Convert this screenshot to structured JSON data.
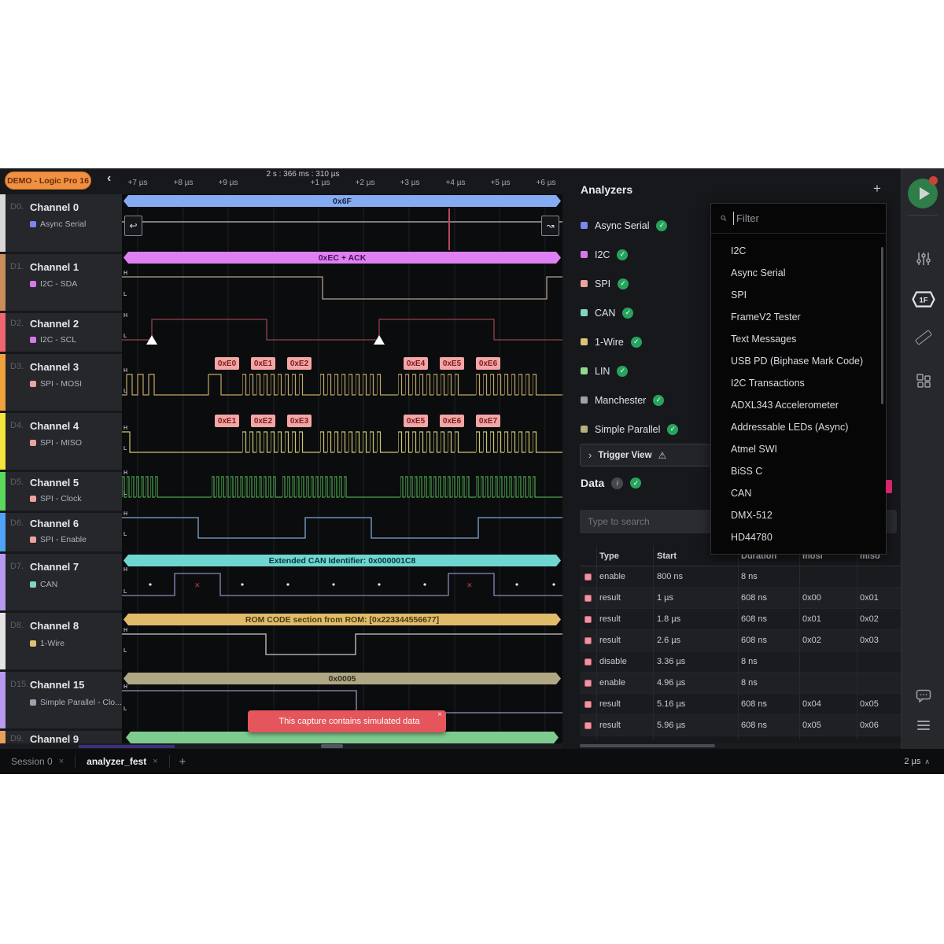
{
  "header": {
    "demo_badge": "DEMO - Logic Pro 16",
    "time_readout": "2 s : 366 ms : 310 µs",
    "ticks": [
      "+7 µs",
      "+8 µs",
      "+9 µs",
      "+1 µs",
      "+2 µs",
      "+3 µs",
      "+4 µs",
      "+5 µs",
      "+6 µs"
    ]
  },
  "channels": [
    {
      "id": "D0.",
      "name": "Channel 0",
      "tag": "Async Serial",
      "color": "#d8d8d8",
      "tag_color": "#7b86ee"
    },
    {
      "id": "D1.",
      "name": "Channel 1",
      "tag": "I2C - SDA",
      "color": "#c98d5a",
      "tag_color": "#d678e8"
    },
    {
      "id": "D2.",
      "name": "Channel 2",
      "tag": "I2C - SCL",
      "color": "#ef6670",
      "tag_color": "#d678e8"
    },
    {
      "id": "D3.",
      "name": "Channel 3",
      "tag": "SPI - MOSI",
      "color": "#f0a23c",
      "tag_color": "#f0a0a0"
    },
    {
      "id": "D4.",
      "name": "Channel 4",
      "tag": "SPI - MISO",
      "color": "#f5e53a",
      "tag_color": "#f0a0a0"
    },
    {
      "id": "D5.",
      "name": "Channel 5",
      "tag": "SPI - Clock",
      "color": "#5ad95a",
      "tag_color": "#f0a0a0"
    },
    {
      "id": "D6.",
      "name": "Channel 6",
      "tag": "SPI - Enable",
      "color": "#4da3f5",
      "tag_color": "#f0a0a0"
    },
    {
      "id": "D7.",
      "name": "Channel 7",
      "tag": "CAN",
      "color": "#b59af0",
      "tag_color": "#7fd4c4"
    },
    {
      "id": "D8.",
      "name": "Channel 8",
      "tag": "1-Wire",
      "color": "#e3e3e3",
      "tag_color": "#dec273"
    },
    {
      "id": "D15.",
      "name": "Channel 15",
      "tag": "Simple Parallel - Clo...",
      "color": "#b59af0",
      "tag_color": "#9aa3ad"
    },
    {
      "id": "D9.",
      "name": "Channel 9",
      "tag": "",
      "color": "#e8a05c",
      "tag_color": ""
    }
  ],
  "waveforms": {
    "ch0_frame": "0x6F",
    "ch0_frame_color": "#85acf2",
    "ch1_frame": "0xEC + ACK",
    "ch1_frame_color": "#df80f2",
    "can_frame": "Extended CAN Identifier: 0x000001C8",
    "can_frame_color": "#6fd6d2",
    "onewire_frame": "ROM CODE section from ROM: [0x223344556677]",
    "onewire_frame_color": "#e0bc6a",
    "parallel_frame": "0x0005",
    "parallel_frame_color": "#b0a884",
    "ch9_frame_color": "#7ecb8f",
    "mosi_badges": [
      "0xE0",
      "0xE1",
      "0xE2",
      "0xE4",
      "0xE5",
      "0xE6"
    ],
    "miso_badges": [
      "0xE1",
      "0xE2",
      "0xE3",
      "0xE5",
      "0xE6",
      "0xE7"
    ],
    "glyph_left": "↩",
    "glyph_right": "↝",
    "h_label": "H",
    "l_label": "L"
  },
  "waveform_colors": {
    "ch0": "#bfbfbf",
    "sda": "#b0a48e",
    "scl": "#96424e",
    "mosi": "#c0a865",
    "miso": "#cfc66e",
    "clock": "#4aa54a",
    "enable": "#7fa8d0",
    "can": "#8d89bd",
    "onewire": "#c8c8c8",
    "parallel": "#9793c2"
  },
  "toast": {
    "text": "This capture contains simulated data"
  },
  "analyzers": {
    "title": "Analyzers",
    "add_button": "+",
    "items": [
      {
        "label": "Async Serial",
        "color": "#7b86ee"
      },
      {
        "label": "I2C",
        "color": "#d678e8"
      },
      {
        "label": "SPI",
        "color": "#f0a0a0"
      },
      {
        "label": "CAN",
        "color": "#7fd4c4"
      },
      {
        "label": "1-Wire",
        "color": "#dec273"
      },
      {
        "label": "LIN",
        "color": "#8fd98f"
      },
      {
        "label": "Manchester",
        "color": "#9aa3ad"
      },
      {
        "label": "Simple Parallel",
        "color": "#b5b080"
      }
    ],
    "trigger_view": "Trigger View"
  },
  "dropdown": {
    "filter_placeholder": "Filter",
    "items": [
      "I2C",
      "Async Serial",
      "SPI",
      "FrameV2 Tester",
      "Text Messages",
      "USB PD (Biphase Mark Code)",
      "I2C Transactions",
      "ADXL343 Accelerometer",
      "Addressable LEDs (Async)",
      "Atmel SWI",
      "BiSS C",
      "CAN",
      "DMX-512",
      "HD44780"
    ]
  },
  "data_panel": {
    "title": "Data",
    "search_placeholder": "Type to search",
    "columns": [
      "Type",
      "Start",
      "Duration",
      "mosi",
      "miso"
    ],
    "rows": [
      {
        "type": "enable",
        "start": "800 ns",
        "duration": "8 ns",
        "mosi": "",
        "miso": ""
      },
      {
        "type": "result",
        "start": "1 µs",
        "duration": "608 ns",
        "mosi": "0x00",
        "miso": "0x01"
      },
      {
        "type": "result",
        "start": "1.8 µs",
        "duration": "608 ns",
        "mosi": "0x01",
        "miso": "0x02"
      },
      {
        "type": "result",
        "start": "2.6 µs",
        "duration": "608 ns",
        "mosi": "0x02",
        "miso": "0x03"
      },
      {
        "type": "disable",
        "start": "3.36 µs",
        "duration": "8 ns",
        "mosi": "",
        "miso": ""
      },
      {
        "type": "enable",
        "start": "4.96 µs",
        "duration": "8 ns",
        "mosi": "",
        "miso": ""
      },
      {
        "type": "result",
        "start": "5.16 µs",
        "duration": "608 ns",
        "mosi": "0x04",
        "miso": "0x05"
      },
      {
        "type": "result",
        "start": "5.96 µs",
        "duration": "608 ns",
        "mosi": "0x05",
        "miso": "0x06"
      }
    ]
  },
  "toolbar": {
    "overlay_badge": "1F"
  },
  "tabs": {
    "session": "Session 0",
    "active": "analyzer_fest"
  },
  "status": {
    "zoom_level": "2 µs"
  }
}
